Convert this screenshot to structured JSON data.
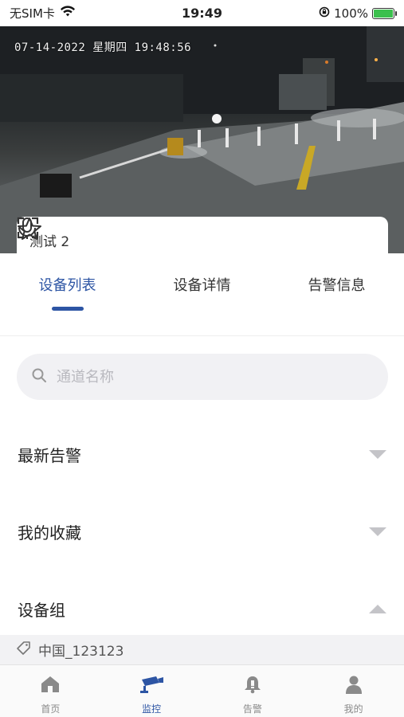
{
  "status_bar": {
    "carrier": "无SIM卡",
    "time": "19:49",
    "battery": "100%",
    "battery_level": 1.0,
    "wifi_icon": "wifi-icon",
    "lock_icon": "orientation-lock-icon"
  },
  "video": {
    "osd_timestamp": "07-14-2022 星期四 19:48:56",
    "camera_name": "测试 2",
    "icons": [
      "microphone-icon",
      "star-icon",
      "fullscreen-icon"
    ]
  },
  "tabs": [
    {
      "label": "设备列表",
      "active": true
    },
    {
      "label": "设备详情",
      "active": false
    },
    {
      "label": "告警信息",
      "active": false
    }
  ],
  "search": {
    "placeholder": "通道名称",
    "value": ""
  },
  "sections": [
    {
      "title": "最新告警",
      "expanded": false
    },
    {
      "title": "我的收藏",
      "expanded": false
    },
    {
      "title": "设备组",
      "expanded": true
    }
  ],
  "group": {
    "name": "中国_123123"
  },
  "bottom_nav": [
    {
      "label": "首页",
      "icon": "home-icon",
      "active": false
    },
    {
      "label": "监控",
      "icon": "camera-icon",
      "active": true
    },
    {
      "label": "告警",
      "icon": "bell-icon",
      "active": false
    },
    {
      "label": "我的",
      "icon": "user-icon",
      "active": false
    }
  ],
  "colors": {
    "accent": "#2d55a4",
    "inactive_nav": "#8a8a8a",
    "battery_green": "#3cc04e"
  }
}
